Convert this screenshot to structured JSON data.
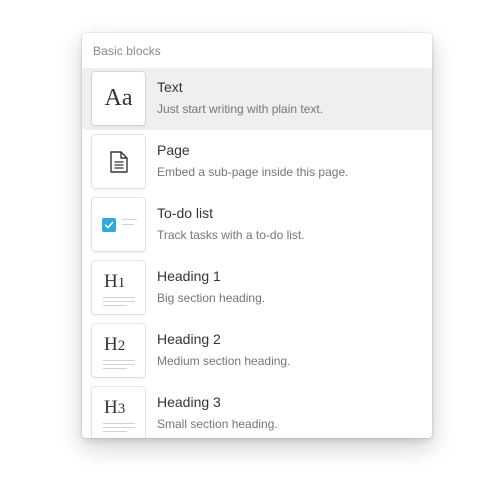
{
  "menu": {
    "section_title": "Basic blocks",
    "items": [
      {
        "label": "Text",
        "description": "Just start writing with plain text.",
        "icon": "text-aa-icon",
        "thumb_text": "Aa",
        "selected": true
      },
      {
        "label": "Page",
        "description": "Embed a sub-page inside this page.",
        "icon": "page-icon"
      },
      {
        "label": "To-do list",
        "description": "Track tasks with a to-do list.",
        "icon": "todo-checkbox-icon"
      },
      {
        "label": "Heading 1",
        "description": "Big section heading.",
        "icon": "heading-1-icon",
        "thumb_text": "H1"
      },
      {
        "label": "Heading 2",
        "description": "Medium section heading.",
        "icon": "heading-2-icon",
        "thumb_text": "H2"
      },
      {
        "label": "Heading 3",
        "description": "Small section heading.",
        "icon": "heading-3-icon",
        "thumb_text": "H3"
      }
    ]
  },
  "colors": {
    "selected_bg": "#efefef",
    "checkbox_accent": "#2eaadc",
    "text_primary": "#37352f",
    "text_secondary": "#77766f"
  }
}
